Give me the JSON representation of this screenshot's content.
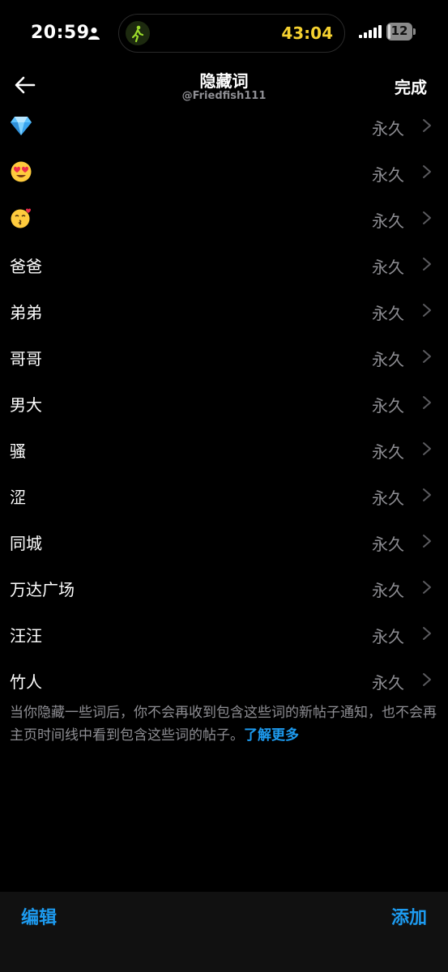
{
  "status_bar": {
    "time": "20:59",
    "timer": "43:04",
    "battery_level": "12",
    "battery_fraction": 0.12
  },
  "header": {
    "title": "隐藏词",
    "subtitle": "@Friedfish111",
    "done_label": "完成"
  },
  "words": [
    {
      "emoji": "diamond-emoji",
      "duration": "永久"
    },
    {
      "emoji": "heart-eyes-emoji",
      "duration": "永久"
    },
    {
      "emoji": "kissing-heart-emoji",
      "duration": "永久"
    },
    {
      "word": "爸爸",
      "duration": "永久"
    },
    {
      "word": "弟弟",
      "duration": "永久"
    },
    {
      "word": "哥哥",
      "duration": "永久"
    },
    {
      "word": "男大",
      "duration": "永久"
    },
    {
      "word": "骚",
      "duration": "永久"
    },
    {
      "word": "涩",
      "duration": "永久"
    },
    {
      "word": "同城",
      "duration": "永久"
    },
    {
      "word": "万达广场",
      "duration": "永久"
    },
    {
      "word": "汪汪",
      "duration": "永久"
    },
    {
      "word": "竹人",
      "duration": "永久"
    }
  ],
  "footer": {
    "note": "当你隐藏一些词后，你不会再收到包含这些词的新帖子通知，也不会再主页时间线中看到包含这些词的帖子。",
    "learn_more": "了解更多"
  },
  "toolbar": {
    "edit_label": "编辑",
    "add_label": "添加"
  },
  "colors": {
    "background": "#000000",
    "accent": "#1d9bf0",
    "secondary_text": "#8e8e93",
    "timer": "#f5d130"
  }
}
